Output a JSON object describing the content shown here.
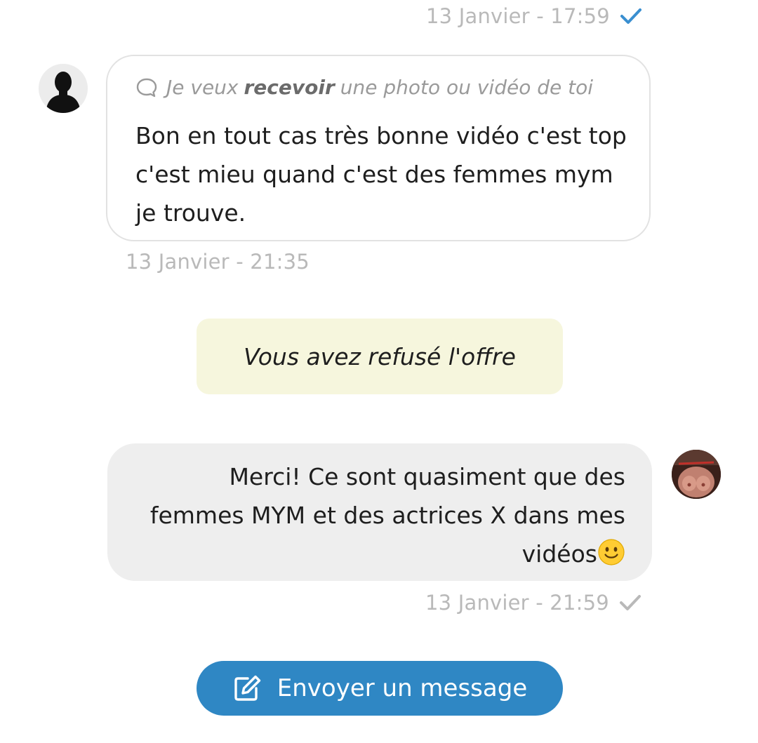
{
  "messages": {
    "first_timestamp": "13 Janvier - 17:59",
    "incoming": {
      "quote_prefix": "Je veux",
      "quote_bold": "recevoir",
      "quote_suffix": "une photo ou vidéo de toi",
      "text": "Bon en tout cas très bonne vidéo c'est top c'est mieu quand c'est des femmes mym je trouve.",
      "timestamp": "13 Janvier - 21:35"
    },
    "offer_notice": "Vous avez refusé l'offre",
    "outgoing": {
      "text": "Merci! Ce sont quasiment que des femmes MYM et des actrices X dans mes vidéos",
      "emoji": "slightly-smiling-face",
      "timestamp": "13 Janvier - 21:59"
    }
  },
  "composer": {
    "send_label": "Envoyer un message",
    "icon": "edit-icon"
  },
  "colors": {
    "accent": "#2f87c4",
    "check_read": "#3a8fd0",
    "check_sent": "#b9b9b9",
    "offer_bg": "#f6f6dd",
    "outgoing_bg": "#eeeeee"
  }
}
